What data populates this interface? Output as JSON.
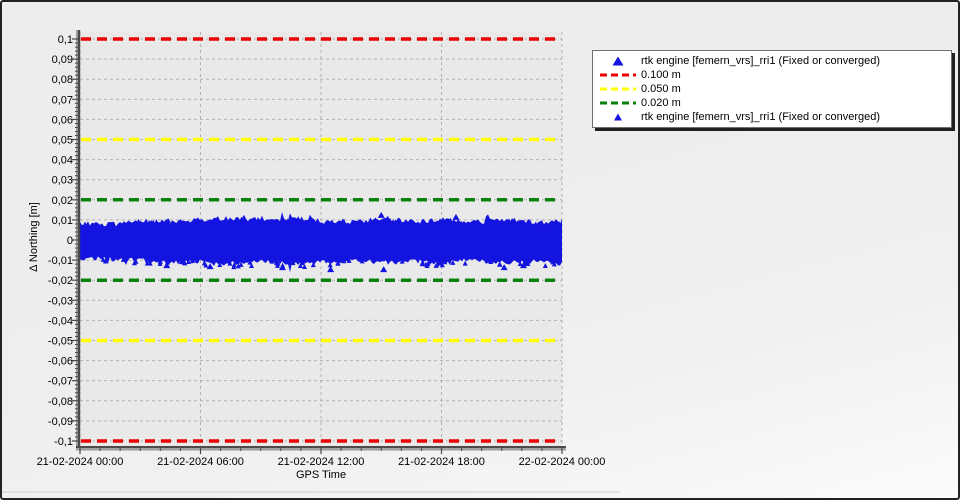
{
  "window": {
    "background_top": "#ededed",
    "background_bottom": "#fbfbfb",
    "border_color": "#222222"
  },
  "chart_data": {
    "type": "scatter",
    "title": "",
    "xlabel": "GPS Time",
    "ylabel": "Δ Northing [m]",
    "x_tick_labels": [
      "21-02-2024 00:00",
      "21-02-2024 06:00",
      "21-02-2024 12:00",
      "21-02-2024 18:00",
      "22-02-2024 00:00"
    ],
    "x_major_tick_hours": 6,
    "x_minor_tick_hours": 1,
    "xlim_hours": [
      0,
      24
    ],
    "y_tick_values": [
      0.1,
      0.09,
      0.08,
      0.07,
      0.06,
      0.05,
      0.04,
      0.03,
      0.02,
      0.01,
      0,
      -0.01,
      -0.02,
      -0.03,
      -0.04,
      -0.05,
      -0.06,
      -0.07,
      -0.08,
      -0.09,
      -0.1
    ],
    "y_tick_labels": [
      "0,1",
      "0,09",
      "0,08",
      "0,07",
      "0,06",
      "0,05",
      "0,04",
      "0,03",
      "0,02",
      "0,01",
      "0",
      "-0,01",
      "-0,02",
      "-0,03",
      "-0,04",
      "-0,05",
      "-0,06",
      "-0,07",
      "-0,08",
      "-0,09",
      "-0,1"
    ],
    "y_minor_tick": 0.002,
    "ylim": [
      -0.1035,
      0.1035
    ],
    "grid": true,
    "thresholds": [
      {
        "label": "0.100 m",
        "value_m": 0.1,
        "color": "#ee0000"
      },
      {
        "label": "0.050 m",
        "value_m": 0.05,
        "color": "#ffff00"
      },
      {
        "label": "0.020 m",
        "value_m": 0.02,
        "color": "#0a820a"
      }
    ],
    "series": [
      {
        "name": "rtk engine [femern_vrs]_rri1 (Fixed or converged)",
        "marker": "triangle",
        "color": "#1414e0",
        "description": "dense noise band of RTK northing residuals around 0 m",
        "envelope_x_fraction": [
          0,
          0.05,
          0.1,
          0.15,
          0.2,
          0.25,
          0.3,
          0.35,
          0.4,
          0.45,
          0.5,
          0.55,
          0.6,
          0.65,
          0.7,
          0.75,
          0.8,
          0.85,
          0.9,
          0.95,
          1
        ],
        "upper_envelope_m": [
          0.007,
          0.0065,
          0.007,
          0.008,
          0.0075,
          0.009,
          0.0095,
          0.009,
          0.0085,
          0.0095,
          0.008,
          0.0075,
          0.0085,
          0.009,
          0.008,
          0.009,
          0.0075,
          0.008,
          0.0085,
          0.0075,
          0.008
        ],
        "lower_envelope_m": [
          -0.0085,
          -0.008,
          -0.0085,
          -0.009,
          -0.01,
          -0.0095,
          -0.0105,
          -0.01,
          -0.0095,
          -0.0105,
          -0.01,
          -0.009,
          -0.0095,
          -0.01,
          -0.0095,
          -0.0105,
          -0.009,
          -0.0095,
          -0.01,
          -0.0095,
          -0.0105
        ],
        "outliers": [
          {
            "x_fraction": 0.18,
            "value_m": -0.0125
          },
          {
            "x_fraction": 0.27,
            "value_m": -0.013
          },
          {
            "x_fraction": 0.34,
            "value_m": 0.011
          },
          {
            "x_fraction": 0.42,
            "value_m": -0.0135
          },
          {
            "x_fraction": 0.52,
            "value_m": -0.0145
          },
          {
            "x_fraction": 0.625,
            "value_m": 0.0125
          },
          {
            "x_fraction": 0.63,
            "value_m": -0.0145
          },
          {
            "x_fraction": 0.78,
            "value_m": 0.0115
          },
          {
            "x_fraction": 0.88,
            "value_m": -0.0135
          },
          {
            "x_fraction": 0.92,
            "value_m": -0.0125
          }
        ]
      }
    ],
    "legend": {
      "position": "top-right-outside",
      "entries": [
        {
          "label": "rtk engine [femern_vrs]_rri1 (Fixed or converged)",
          "marker": "triangle",
          "color": "#1414e0",
          "size": "large"
        },
        {
          "label": "0.100 m",
          "marker": "dashed-line",
          "color": "#ee0000"
        },
        {
          "label": "0.050 m",
          "marker": "dashed-line",
          "color": "#ffff00"
        },
        {
          "label": "0.020 m",
          "marker": "dashed-line",
          "color": "#0a820a"
        },
        {
          "label": "rtk engine [femern_vrs]_rri1 (Fixed or converged)",
          "marker": "triangle",
          "color": "#1414e0",
          "size": "small"
        }
      ]
    },
    "colors": {
      "plot_bg": "#e9e9e9",
      "grid": "#b3b3b3",
      "axis": "#4a4a4a",
      "axis_shadow": "#9c9c9c",
      "text": "#000000"
    }
  }
}
